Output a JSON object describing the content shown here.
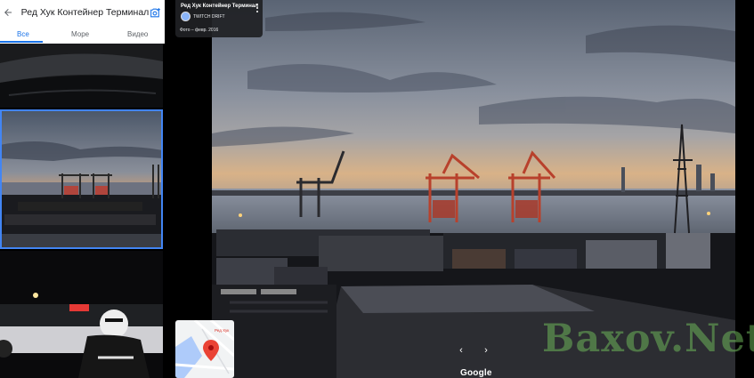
{
  "panel": {
    "title": "Ред Хук Контейнер Терминал",
    "tabs": [
      {
        "label": "Все",
        "active": true
      },
      {
        "label": "Море",
        "active": false
      },
      {
        "label": "Видео",
        "active": false
      }
    ],
    "thumbnails": [
      {
        "subject": "car interior dashboard",
        "selected": false
      },
      {
        "subject": "port sunset cranes",
        "selected": true
      },
      {
        "subject": "cyclist night race",
        "selected": false
      }
    ]
  },
  "info_card": {
    "title": "Ред Хук Контейнер Терминал",
    "author": "TWITCH DRIFT",
    "date": "Фото – февр. 2016"
  },
  "map": {
    "pin_label": "Ред Хук"
  },
  "navigation": {
    "prev": "‹",
    "next": "›"
  },
  "branding": {
    "google": "Google"
  },
  "watermark": {
    "text": "Baxov.Net"
  },
  "colors": {
    "accent": "#1a73e8",
    "selected_outline": "#4285f4",
    "card_bg": "#202124"
  }
}
